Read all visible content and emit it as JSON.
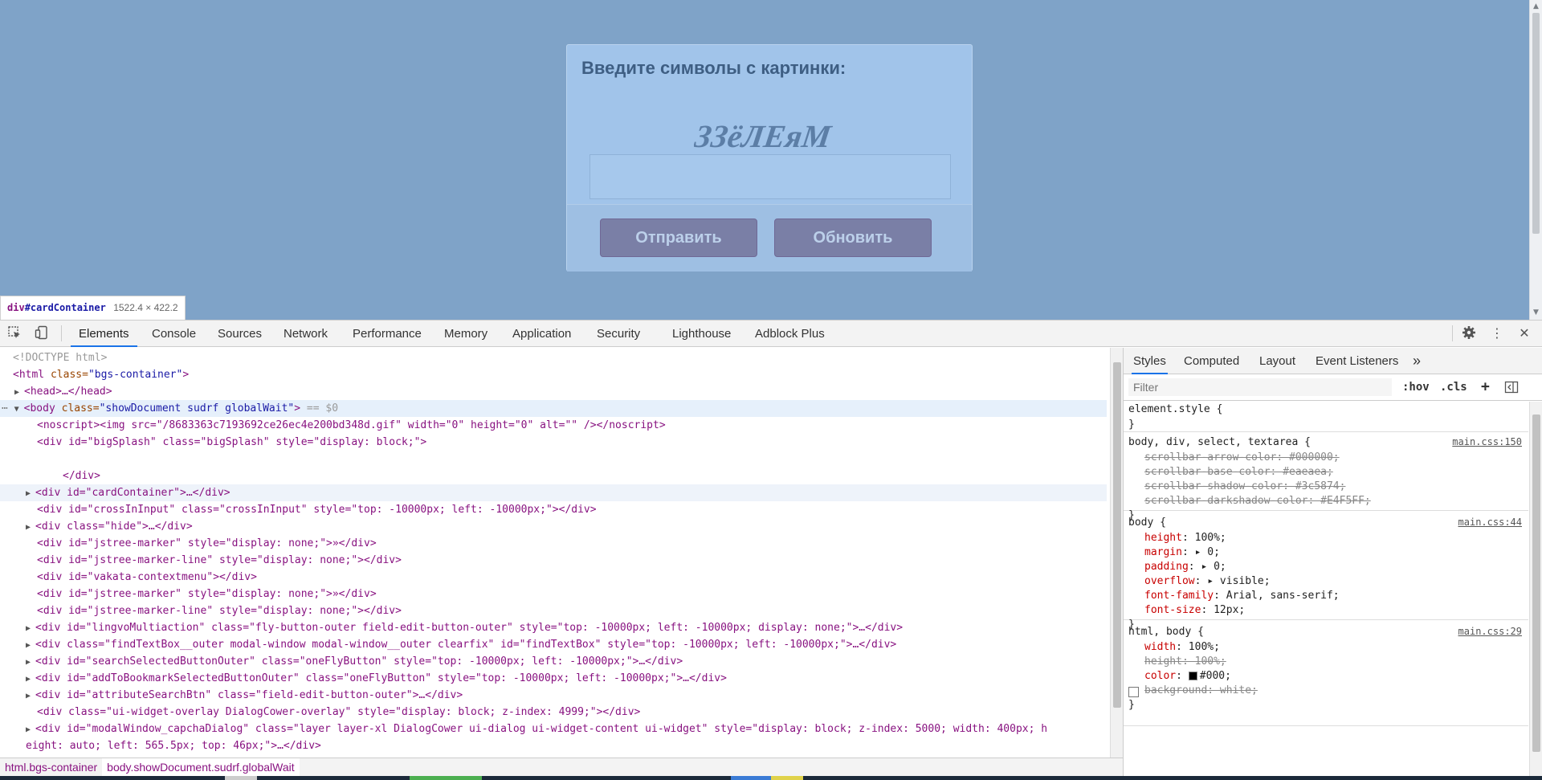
{
  "page": {
    "background": "#7fa3c8",
    "captcha": {
      "prompt": "Введите символы с картинки:",
      "image_text": "ЗЗёЛЕяМ",
      "input_value": "",
      "send_label": "Отправить",
      "refresh_label": "Обновить"
    },
    "tooltip": {
      "tag": "div",
      "id": "#cardContainer",
      "size": "1522.4 × 422.2"
    }
  },
  "devtools": {
    "tabs": [
      "Elements",
      "Console",
      "Sources",
      "Network",
      "Performance",
      "Memory",
      "Application",
      "Security",
      "Lighthouse",
      "Adblock Plus"
    ],
    "active_tab": "Elements",
    "icons": {
      "inspect": "inspect-icon",
      "device": "device-toolbar-icon",
      "settings": "gear-icon",
      "more": "more-vertical-icon",
      "close": "close-icon"
    },
    "dom_lines": {
      "l0": "<!DOCTYPE html>",
      "l1_tag": "<html",
      "l1_attr": " class=",
      "l1_val": "\"bgs-container\"",
      "l1_end": ">",
      "l2": "<head>…</head>",
      "l3_tag": "<body",
      "l3_attr": " class=",
      "l3_val": "\"showDocument sudrf globalWait\"",
      "l3_end": ">",
      "l3_marker": " == $0",
      "l4": "<noscript><img src=\"/8683363c7193692ce26ec4e200bd348d.gif\" width=\"0\" height=\"0\" alt=\"\" /></noscript>",
      "l5": "<div id=\"bigSplash\" class=\"bigSplash\" style=\"display: block;\">",
      "l6": "</div>",
      "l7": "<div id=\"cardContainer\">…</div>",
      "l8": "<div id=\"crossInInput\" class=\"crossInInput\" style=\"top: -10000px; left: -10000px;\"></div>",
      "l9": "<div class=\"hide\">…</div>",
      "l10": "<div id=\"jstree-marker\" style=\"display: none;\">»</div>",
      "l11": "<div id=\"jstree-marker-line\" style=\"display: none;\"></div>",
      "l12": "<div id=\"vakata-contextmenu\"></div>",
      "l13": "<div id=\"jstree-marker\" style=\"display: none;\">»</div>",
      "l14": "<div id=\"jstree-marker-line\" style=\"display: none;\"></div>",
      "l15": "<div id=\"lingvoMultiaction\" class=\"fly-button-outer field-edit-button-outer\" style=\"top: -10000px; left: -10000px; display: none;\">…</div>",
      "l16": "<div class=\"findTextBox__outer modal-window modal-window__outer clearfix\" id=\"findTextBox\" style=\"top: -10000px; left: -10000px;\">…</div>",
      "l17": "<div id=\"searchSelectedButtonOuter\" class=\"oneFlyButton\" style=\"top: -10000px; left: -10000px;\">…</div>",
      "l18": "<div id=\"addToBookmarkSelectedButtonOuter\" class=\"oneFlyButton\" style=\"top: -10000px; left: -10000px;\">…</div>",
      "l19": "<div id=\"attributeSearchBtn\" class=\"field-edit-button-outer\">…</div>",
      "l20": "<div class=\"ui-widget-overlay DialogCower-overlay\" style=\"display: block; z-index: 4999;\"></div>",
      "l21": "<div id=\"modalWindow_capchaDialog\" class=\"layer layer-xl DialogCower ui-dialog ui-widget-content ui-widget\" style=\"display: block; z-index: 5000; width: 400px; h",
      "l22": "eight: auto; left: 565.5px; top: 46px;\">…</div>"
    },
    "breadcrumbs": [
      "html.bgs-container",
      "body.showDocument.sudrf.globalWait"
    ],
    "styles": {
      "tabs": [
        "Styles",
        "Computed",
        "Layout",
        "Event Listeners"
      ],
      "more_tabs": "»",
      "filter_placeholder": "Filter",
      "hov": ":hov",
      "cls": ".cls",
      "plus": "+",
      "rule0": {
        "selector": "element.style {",
        "close": "}"
      },
      "rule1": {
        "selector": "body, div, select, textarea {",
        "source": "main.css:150",
        "p1": "scrollbar-arrow-color: #000000;",
        "p2": "scrollbar-base-color: #eaeaea;",
        "p3": "scrollbar-shadow-color: #3c5874;",
        "p4": "scrollbar-darkshadow-color: #E4F5FF;",
        "close": "}"
      },
      "rule2": {
        "selector": "body {",
        "source": "main.css:44",
        "p1n": "height",
        "p1v": ": 100%;",
        "p2n": "margin",
        "p2v": ": ▸ 0;",
        "p3n": "padding",
        "p3v": ": ▸ 0;",
        "p4n": "overflow",
        "p4v": ": ▸ visible;",
        "p5n": "font-family",
        "p5v": ": Arial, sans-serif;",
        "p6n": "font-size",
        "p6v": ": 12px;",
        "close": "}"
      },
      "rule3": {
        "selector": "html, body {",
        "source": "main.css:29",
        "p1n": "width",
        "p1v": ": 100%;",
        "p2": "height: 100%;",
        "p3n": "color",
        "p3v": "#000;",
        "p4": "background: white;",
        "close": "}"
      }
    }
  },
  "colors": {
    "accent": "#1a73e8",
    "tag": "#881280",
    "attr_name": "#994500",
    "attr_value": "#1a1aa6",
    "prop_name": "#c80000"
  }
}
